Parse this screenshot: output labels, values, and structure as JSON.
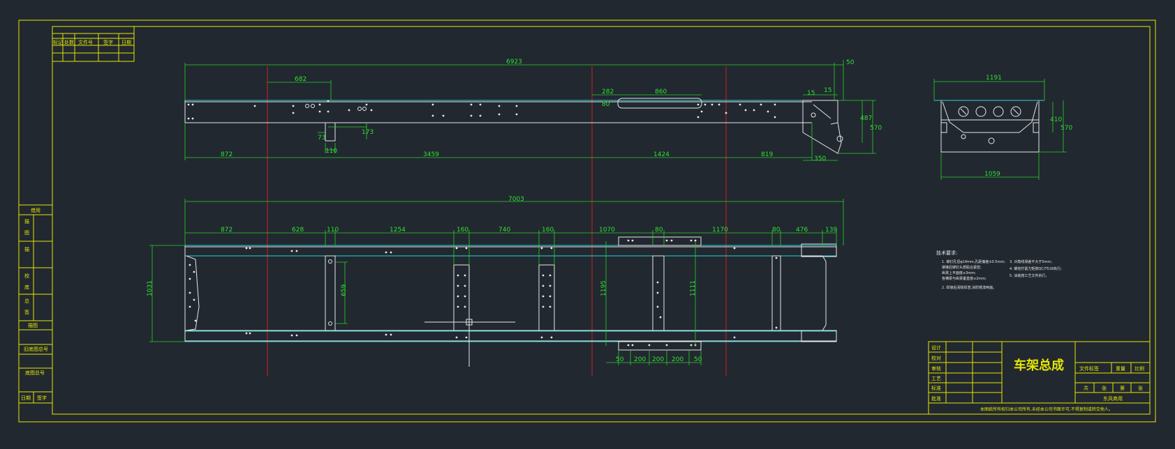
{
  "title_block": {
    "drawing_title": "车架总成",
    "rows": [
      "设计",
      "校对",
      "审核",
      "工艺",
      "标准",
      "批准"
    ],
    "header": [
      "文件标签",
      "重量",
      "比例"
    ],
    "sub": [
      "共",
      "张",
      "第",
      "张"
    ],
    "company": "东风商用",
    "notice": "本图纸所有权归本公司所有,未经本公司书面许可,不得复制或转交他人。"
  },
  "revision_table": {
    "headers": [
      "标记",
      "处数",
      "文件号",
      "签字",
      "日期"
    ]
  },
  "left_strip": {
    "labels": [
      "借用",
      "描",
      "图",
      "描",
      "校",
      "底",
      "图",
      "总",
      "号",
      "签",
      "字",
      "日期",
      "旧底图总号",
      "底图总号",
      "日期",
      "签字"
    ],
    "header": "借用",
    "vertical_labels": [
      "描",
      "描",
      "校",
      "图",
      "底",
      "总",
      "签"
    ],
    "mid": "描图",
    "old_base": "旧底图总号",
    "base": "底图总号",
    "date": "日期",
    "sign": "签字"
  },
  "notes": {
    "title": "技术要求:",
    "lines": [
      "1. 铆钉孔径φ14mm,孔距偏差±0.5mm;",
      "   铆接后铆钉头部贴合紧密;",
      "   纵梁上平面度≤3mm;",
      "   各横梁与纵梁垂直度≤2mm;",
      "2. 焊接后清除焊渣,涂防锈漆两遍。",
      "3. 对角线误差不大于5mm;",
      "4. 螺栓拧紧力矩按QC/T518执行;",
      "5. 涂装按工艺文件执行。"
    ]
  },
  "dims": {
    "side": {
      "overall": "6923",
      "top_50": "50",
      "d_682": "682",
      "d_282": "282",
      "d_860": "860",
      "d_80": "80",
      "d_15a": "15",
      "d_15b": "15",
      "d_73": "73",
      "d_173": "173",
      "d_110": "110",
      "d_872": "872",
      "d_3459": "3459",
      "d_1424": "1424",
      "d_819": "819",
      "d_350": "350",
      "d_487": "487",
      "d_570": "570"
    },
    "plan": {
      "overall": "7003",
      "s1": "872",
      "s2": "628",
      "s3": "110",
      "s4": "1254",
      "s5": "160",
      "s6": "740",
      "s7": "160",
      "s8": "1070",
      "s9": "80",
      "s10": "1170",
      "s11": "80",
      "s12": "476",
      "s13": "139",
      "width": "1031",
      "inner": "659",
      "w2": "1195",
      "w3": "1111",
      "b1": "50",
      "b2": "200",
      "b3": "200",
      "b4": "200",
      "b5": "50"
    },
    "end": {
      "top": "1191",
      "bottom": "1059",
      "h1": "410",
      "h2": "570"
    }
  }
}
